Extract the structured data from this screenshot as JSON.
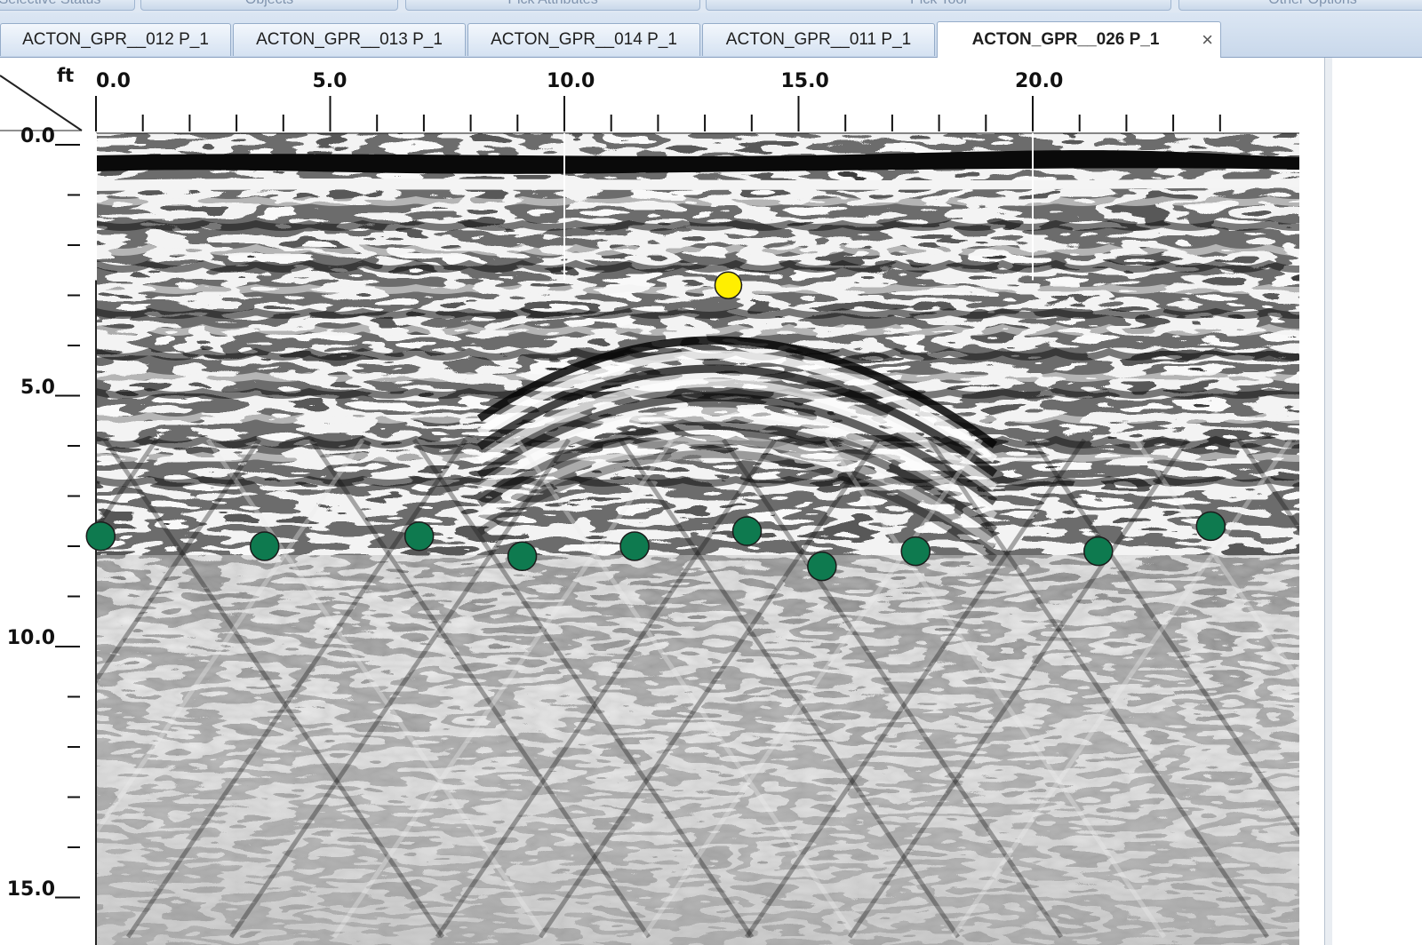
{
  "ribbon": {
    "groups": [
      "Selective Status",
      "Objects",
      "Pick Attributes",
      "Pick Tool",
      "Other Options"
    ]
  },
  "tabs": [
    {
      "label": "ACTON_GPR__012 P_1",
      "active": false
    },
    {
      "label": "ACTON_GPR__013 P_1",
      "active": false
    },
    {
      "label": "ACTON_GPR__014 P_1",
      "active": false
    },
    {
      "label": "ACTON_GPR__011 P_1",
      "active": false
    },
    {
      "label": "ACTON_GPR__026 P_1",
      "active": true
    }
  ],
  "tab_close_glyph": "×",
  "viewer": {
    "unit": "ft",
    "x_ticks": [
      "0.0",
      "5.0",
      "10.0",
      "15.0",
      "20.0"
    ],
    "depth_ticks": [
      "0.0",
      "5.0",
      "10.0",
      "15.0"
    ],
    "x_range_ft": [
      0,
      25.6
    ],
    "depth_range_ft": [
      0,
      15.5
    ]
  },
  "chart_data": {
    "type": "scatter",
    "xlabel": "ft",
    "ylabel": "",
    "series": [
      {
        "color": "#ffef00",
        "points": [
          [
            13.5,
            2.8
          ]
        ]
      },
      {
        "color": "#0e7a4f",
        "points": [
          [
            0.1,
            7.8
          ],
          [
            3.6,
            8.0
          ],
          [
            6.9,
            7.8
          ],
          [
            9.1,
            8.2
          ],
          [
            11.5,
            8.0
          ],
          [
            13.9,
            7.7
          ],
          [
            15.5,
            8.4
          ],
          [
            17.5,
            8.1
          ],
          [
            21.4,
            8.1
          ],
          [
            23.8,
            7.6
          ]
        ]
      }
    ],
    "xlim": [
      0,
      25.6
    ],
    "ylim": [
      0,
      15.5
    ]
  },
  "colors": {
    "tab_bg": "#dbe6f3",
    "apex_marker": "#ffef00",
    "interface_marker": "#0e7a4f"
  }
}
